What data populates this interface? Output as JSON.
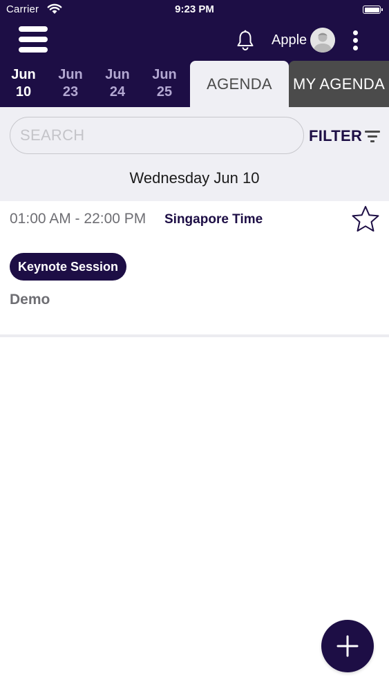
{
  "status_bar": {
    "carrier": "Carrier",
    "time": "9:23 PM"
  },
  "header": {
    "username": "Apple",
    "icons": [
      "menu-icon",
      "bell-icon",
      "avatar-icon",
      "more-vertical-icon"
    ]
  },
  "dates": [
    {
      "month": "Jun",
      "day": "10",
      "active": true
    },
    {
      "month": "Jun",
      "day": "23",
      "active": false
    },
    {
      "month": "Jun",
      "day": "24",
      "active": false
    },
    {
      "month": "Jun",
      "day": "25",
      "active": false
    }
  ],
  "tabs": {
    "agenda": "AGENDA",
    "my_agenda": "MY AGENDA"
  },
  "search": {
    "placeholder": "SEARCH",
    "value": ""
  },
  "filter": {
    "label": "FILTER"
  },
  "day_header": "Wednesday Jun 10",
  "session": {
    "time": "01:00 AM - 22:00 PM",
    "timezone": "Singapore Time",
    "badge": "Keynote Session",
    "title": "Demo",
    "starred": false
  },
  "colors": {
    "primary": "#1d0e45",
    "tab_inactive": "#4b4b4b",
    "panel_bg": "#efeff4",
    "date_inactive": "#b3a8d2"
  }
}
